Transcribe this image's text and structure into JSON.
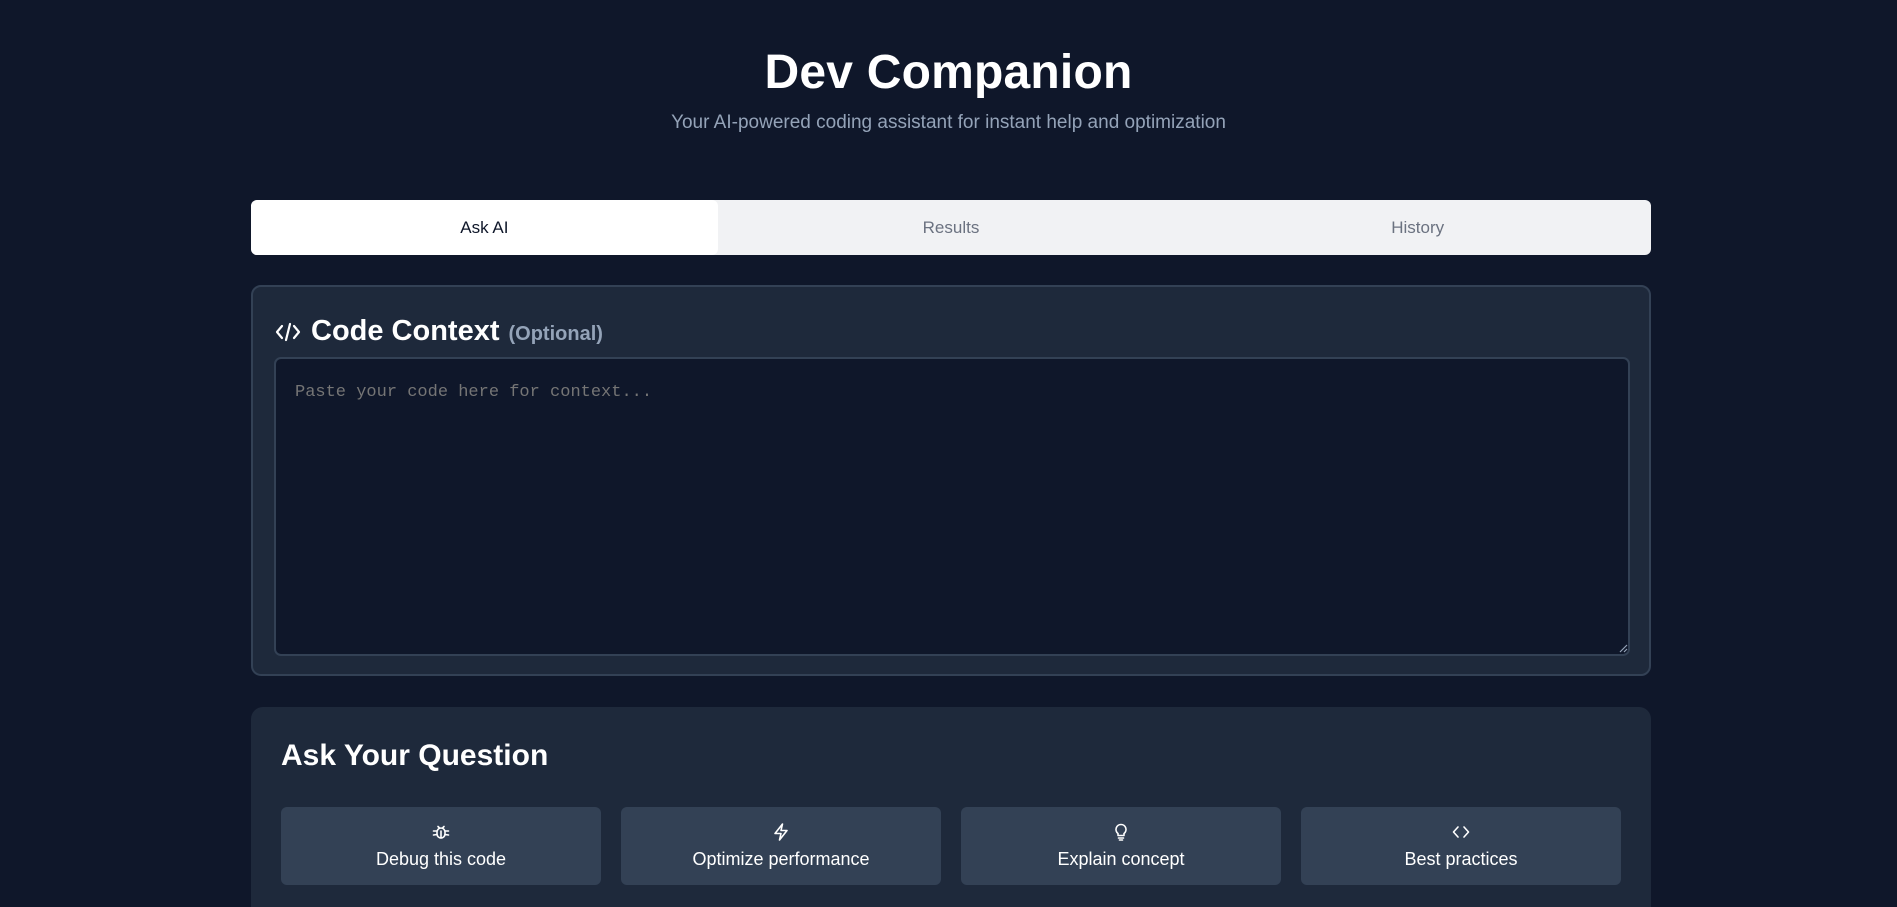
{
  "header": {
    "title": "Dev Companion",
    "subtitle": "Your AI-powered coding assistant for instant help and optimization"
  },
  "tabs": [
    {
      "label": "Ask AI",
      "active": true
    },
    {
      "label": "Results",
      "active": false
    },
    {
      "label": "History",
      "active": false
    }
  ],
  "code_context": {
    "icon": "code-icon",
    "title": "Code Context",
    "optional_label": "(Optional)",
    "placeholder": "Paste your code here for context...",
    "value": ""
  },
  "ask_question": {
    "title": "Ask Your Question",
    "quick_actions": [
      {
        "label": "Debug this code",
        "icon": "bug-icon"
      },
      {
        "label": "Optimize performance",
        "icon": "lightning-icon"
      },
      {
        "label": "Explain concept",
        "icon": "lightbulb-icon"
      },
      {
        "label": "Best practices",
        "icon": "code-brackets-icon"
      }
    ]
  },
  "colors": {
    "background": "#0f172a",
    "card": "#1e293b",
    "border": "#334155",
    "button": "#334155",
    "muted_text": "#94a3b8",
    "tab_bar": "#f1f2f4"
  }
}
